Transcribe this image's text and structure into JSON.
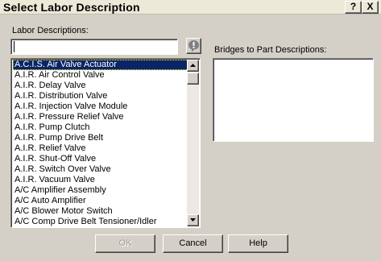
{
  "window": {
    "title": "Select Labor Description",
    "help_glyph": "?",
    "close_glyph": "X"
  },
  "labor": {
    "label": "Labor Descriptions:",
    "search_value": "",
    "items": [
      "A.C.I.S. Air Valve Actuator",
      "A.I.R. Air Control Valve",
      "A.I.R. Delay Valve",
      "A.I.R. Distribution Valve",
      "A.I.R. Injection Valve Module",
      "A.I.R. Pressure Relief Valve",
      "A.I.R. Pump Clutch",
      "A.I.R. Pump Drive Belt",
      "A.I.R. Relief Valve",
      "A.I.R. Shut-Off Valve",
      "A.I.R. Switch Over Valve",
      "A.I.R. Vacuum Valve",
      "A/C Amplifier Assembly",
      "A/C Auto Amplifier",
      "A/C Blower Motor Switch",
      "A/C Comp Drive Belt Tensioner/Idler"
    ],
    "selected_index": 0
  },
  "bridges": {
    "label": "Bridges to Part Descriptions:"
  },
  "buttons": {
    "ok": "OK",
    "cancel": "Cancel",
    "help": "Help"
  },
  "icons": {
    "alert": "alert-icon",
    "scroll_up": "scroll-up-arrow-icon",
    "scroll_down": "scroll-down-arrow-icon"
  },
  "colors": {
    "selection": "#0a246a",
    "dialog_bg": "#d4d0c8"
  }
}
